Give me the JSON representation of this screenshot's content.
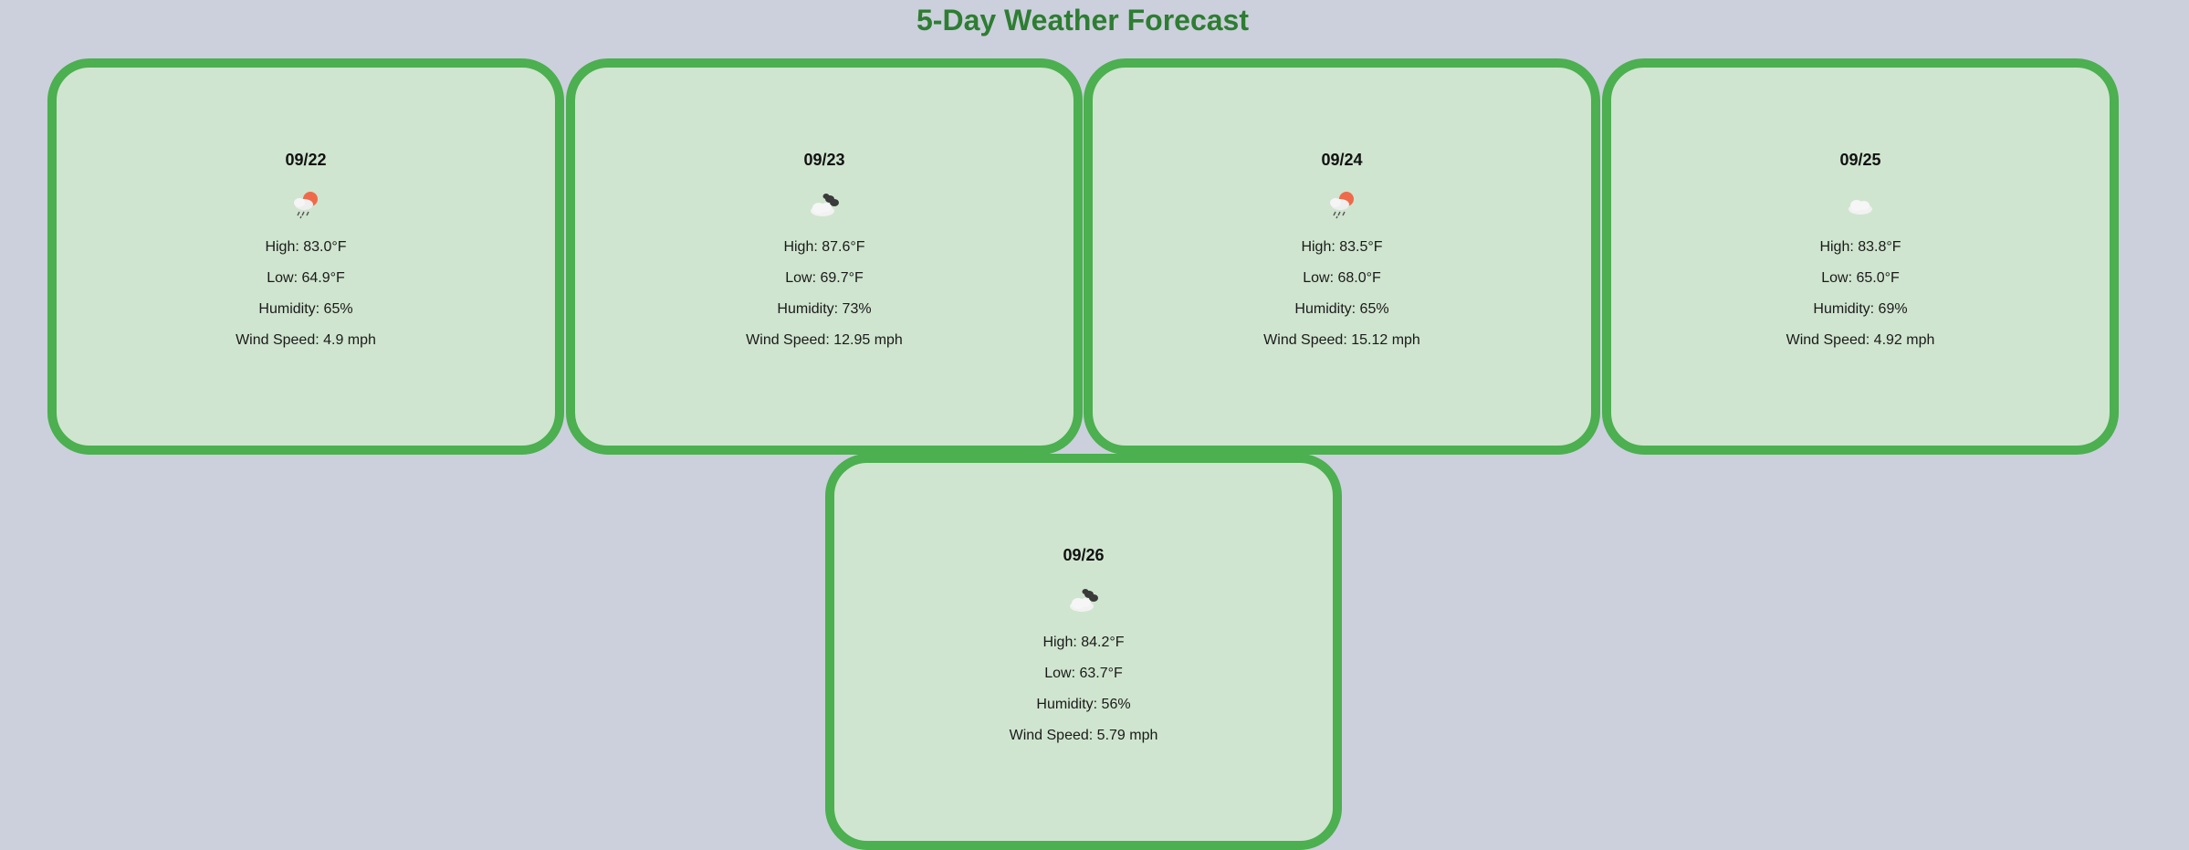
{
  "page": {
    "title": "5-Day Weather Forecast"
  },
  "forecast": [
    {
      "date": "09/22",
      "icon": "sun-cloud-rain-icon",
      "high": "High: 83.0°F",
      "low": "Low: 64.9°F",
      "humidity": "Humidity: 65%",
      "wind": "Wind Speed: 4.9 mph"
    },
    {
      "date": "09/23",
      "icon": "broken-clouds-icon",
      "high": "High: 87.6°F",
      "low": "Low: 69.7°F",
      "humidity": "Humidity: 73%",
      "wind": "Wind Speed: 12.95 mph"
    },
    {
      "date": "09/24",
      "icon": "sun-cloud-rain-icon",
      "high": "High: 83.5°F",
      "low": "Low: 68.0°F",
      "humidity": "Humidity: 65%",
      "wind": "Wind Speed: 15.12 mph"
    },
    {
      "date": "09/25",
      "icon": "cloud-icon",
      "high": "High: 83.8°F",
      "low": "Low: 65.0°F",
      "humidity": "Humidity: 69%",
      "wind": "Wind Speed: 4.92 mph"
    },
    {
      "date": "09/26",
      "icon": "broken-clouds-icon",
      "high": "High: 84.2°F",
      "low": "Low: 63.7°F",
      "humidity": "Humidity: 56%",
      "wind": "Wind Speed: 5.79 mph"
    }
  ],
  "colors": {
    "background": "#cbd0dc",
    "title": "#2e7d32",
    "card_border": "#4caf50",
    "card_fill": "#cfe5cf"
  }
}
